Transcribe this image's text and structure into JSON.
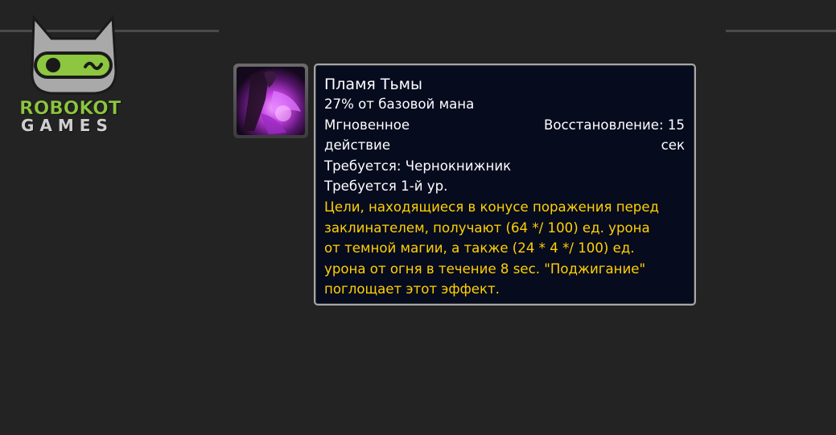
{
  "logo": {
    "line1": "ROBOKOT",
    "line2": "GAMES",
    "accent_color": "#8dc63f"
  },
  "spell": {
    "icon": "shadowflame-icon",
    "name": "Пламя Тьмы",
    "cost": "27% от базовой мана",
    "cast_line1": "Мгновенное",
    "cast_line2": "действие",
    "cooldown_line1": "Восстановление: 15",
    "cooldown_line2": "сек",
    "requires_class": "Требуется: Чернокнижник",
    "requires_level": "Требуется 1-й ур.",
    "description_lines": [
      "Цели, находящиеся в конусе поражения перед",
      "заклинателем, получают (64 */ 100) ед. урона",
      "от темной магии, а также (24 * 4 */ 100) ед.",
      "урона от огня в течение 8 sec. \"Поджигание\"",
      "поглощает этот эффект."
    ],
    "description_color": "#ffd100"
  }
}
